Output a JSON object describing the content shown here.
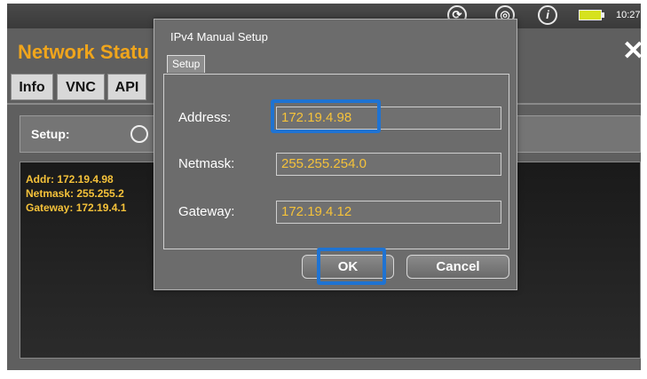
{
  "status_bar": {
    "clock": "10:27",
    "icons": [
      "sync-icon",
      "settings-icon",
      "info-icon",
      "battery-icon"
    ]
  },
  "window": {
    "title": "Network Statu",
    "close_glyph": "✕"
  },
  "tabs": [
    {
      "label": "Info"
    },
    {
      "label": "VNC"
    },
    {
      "label": "API"
    }
  ],
  "setup_row": {
    "label": "Setup:"
  },
  "info_panel": {
    "addr": "Addr: 172.19.4.98",
    "netmask": "Netmask: 255.255.2",
    "gateway": "Gateway: 172.19.4.1"
  },
  "dialog": {
    "title": "IPv4 Manual Setup",
    "tab_label": "Setup",
    "fields": {
      "address": {
        "label": "Address:",
        "value": "172.19.4.98"
      },
      "netmask": {
        "label": "Netmask:",
        "value": "255.255.254.0"
      },
      "gateway": {
        "label": "Gateway:",
        "value": "172.19.4.12"
      }
    },
    "ok_label": "OK",
    "cancel_label": "Cancel"
  },
  "colors": {
    "accent_orange": "#f0a51c",
    "value_yellow": "#f5c23a",
    "highlight_blue": "#1f73d2"
  }
}
